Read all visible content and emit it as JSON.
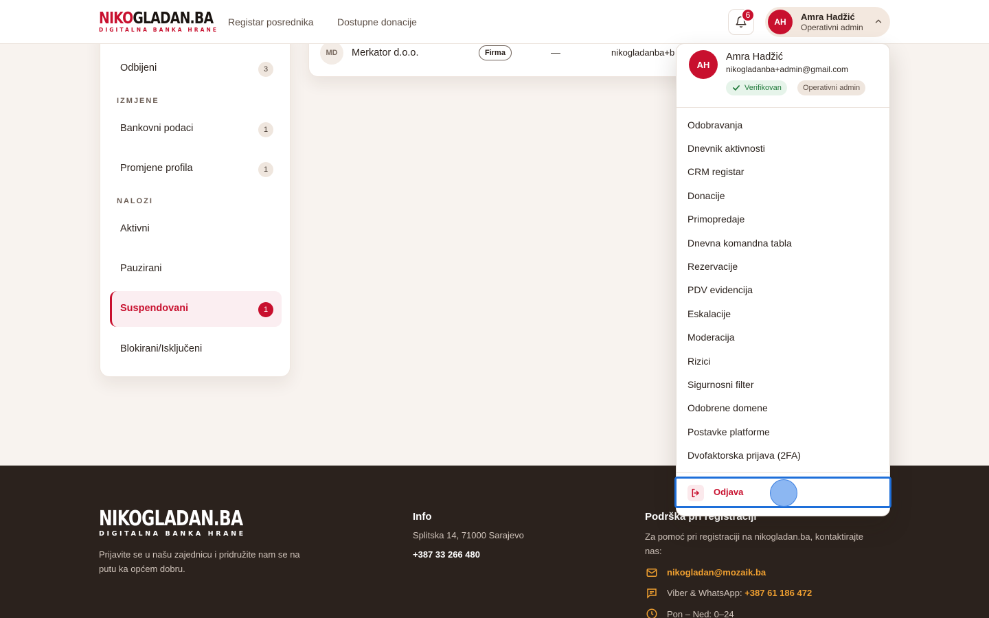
{
  "header": {
    "logo_red": "NIKO",
    "logo_dark": "GLADAN.BA",
    "logo_tagline": "DIGITALNA BANKA HRANE",
    "nav": [
      "Registar posrednika",
      "Dostupne donacije"
    ],
    "notifications_count": "6",
    "user_initials": "AH",
    "user_name": "Amra Hadžić",
    "user_role": "Operativni admin"
  },
  "sidebar": {
    "top_item": {
      "label": "Odbijeni",
      "count": "3"
    },
    "sections": [
      {
        "title": "IZMJENE",
        "items": [
          {
            "label": "Bankovni podaci",
            "count": "1"
          },
          {
            "label": "Promjene profila",
            "count": "1"
          }
        ]
      },
      {
        "title": "NALOZI",
        "items": [
          {
            "label": "Aktivni"
          },
          {
            "label": "Pauzirani"
          },
          {
            "label": "Suspendovani",
            "count": "1",
            "active": true
          },
          {
            "label": "Blokirani/Isključeni"
          }
        ]
      }
    ]
  },
  "table": {
    "row": {
      "initials": "MD",
      "name": "Merkator d.o.o.",
      "type": "Firma",
      "dash": "—",
      "email": "nikogladanba+b"
    }
  },
  "dropdown": {
    "initials": "AH",
    "name": "Amra Hadžić",
    "email": "nikogladanba+admin@gmail.com",
    "verified": "Verifikovan",
    "role": "Operativni admin",
    "items": [
      "Odobravanja",
      "Dnevnik aktivnosti",
      "CRM registar",
      "Donacije",
      "Primopredaje",
      "Dnevna komandna tabla",
      "Rezervacije",
      "PDV evidencija",
      "Eskalacije",
      "Moderacija",
      "Rizici",
      "Sigurnosni filter",
      "Odobrene domene",
      "Postavke platforme",
      "Dvofaktorska prijava (2FA)"
    ],
    "logout": "Odjava"
  },
  "footer": {
    "logo_main": "NIKOGLADAN.BA",
    "logo_tagline": "DIGITALNA BANKA HRANE",
    "about_line1": "Prijavite se u našu zajednicu i pridružite nam se na",
    "about_line2": "putu ka općem dobru.",
    "info_title": "Info",
    "address": "Splitska 14, 71000 Sarajevo",
    "phone": "+387 33 266 480",
    "support_title": "Podrška pri registraciji",
    "support_line1": "Za pomoć pri registraciji na nikogladan.ba, kontaktirajte",
    "support_line2": "nas:",
    "support_email": "nikogladan@mozaik.ba",
    "viber_label": "Viber & WhatsApp:",
    "viber_phone": "+387 61 186 472",
    "hours": "Pon – Ned: 0–24"
  },
  "colors": {
    "brand": "#c8102e",
    "footer_bg": "#2b221d",
    "accent": "#f0a030",
    "focus": "#1e6fd9"
  }
}
